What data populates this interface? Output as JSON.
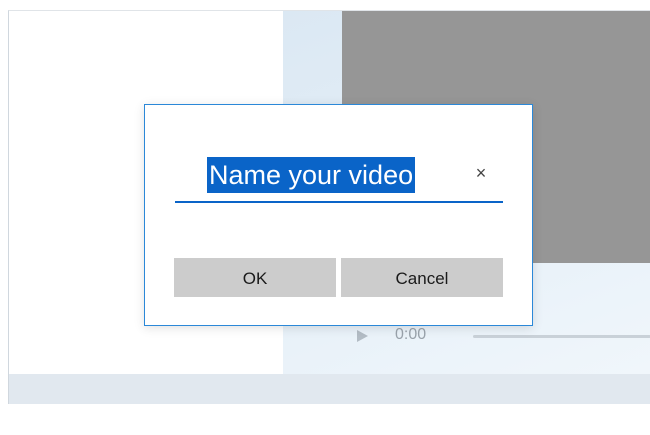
{
  "player": {
    "time": "0:00"
  },
  "dialog": {
    "input_value": "Name your video",
    "clear_glyph": "×",
    "ok_label": "OK",
    "cancel_label": "Cancel"
  },
  "colors": {
    "accent": "#0a64c8",
    "dialog_border": "#2b88d8",
    "button_bg": "#cccccc",
    "preview_gray": "#969696"
  },
  "icons": {
    "play": "play-icon",
    "clear": "close-icon"
  }
}
